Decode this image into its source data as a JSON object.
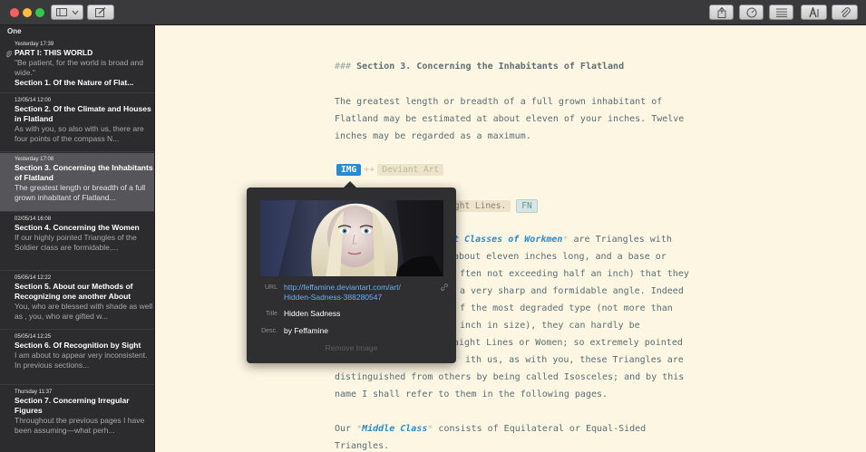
{
  "titlebar": {
    "icons": [
      "sidebar-toggle-icon",
      "chevron-down-icon",
      "compose-icon",
      "share-icon",
      "stats-icon",
      "list-icon",
      "typography-icon",
      "attachment-icon"
    ]
  },
  "sidebar": {
    "header": "One",
    "notes": [
      {
        "date": "Yesterday 17:39",
        "title": "PART I: THIS WORLD",
        "excerpt": "\"Be patient, for the world is broad and wide.\"",
        "excerpt_bold": "Section 1. Of the Nature of Flat...",
        "attached": true
      },
      {
        "date": "12/05/14 12:00",
        "title": "Section 2. Of the Climate and Houses in Flatland",
        "excerpt": "As with you, so also with us, there are four points of the compass N..."
      },
      {
        "date": "Yesterday 17:08",
        "title": "Section 3. Concerning the Inhabitants of Flatland",
        "excerpt": "The greatest length or breadth of a full grown inhabitant of Flatland...",
        "selected": true
      },
      {
        "date": "02/05/14 16:08",
        "title": "Section 4. Concerning the Women",
        "excerpt": "If our highly pointed Triangles of the Soldier class are formidable,..."
      },
      {
        "date": "05/05/14 12:22",
        "title": "Section 5. About our Methods of Recognizing one another About",
        "excerpt": "You, who are blessed with shade as well as , you, who are gifted w..."
      },
      {
        "date": "05/05/14 12:25",
        "title": "Section 6. Of Recognition by Sight",
        "excerpt": "I am about to appear very inconsistent. In previous sections..."
      },
      {
        "date": "Thursday 11:37",
        "title": "Section 7. Concerning Irregular Figures",
        "excerpt": "Throughout the previous pages I have been assuming—what perh..."
      }
    ]
  },
  "editor": {
    "heading_marker": "###",
    "heading_text": "Section 3. Concerning the Inhabitants of Flatland",
    "para1": [
      "The greatest length or breadth of a full grown inhabitant of",
      "Flatland may be estimated at about eleven of your inches. Twelve",
      "inches may be regarded as a maximum."
    ],
    "img_tag": "IMG",
    "img_arrows": "++",
    "deviant_tag": "Deviant Art",
    "sl_tag": "ght Lines.",
    "fn_tag": "FN",
    "workmen_em": "st Classes of Workmen",
    "workmen_mark": "*",
    "workmen_rest": " are Triangles with",
    "lines": [
      "about eleven inches long, and a base or",
      "ften not exceeding half an inch) that they",
      "a very sharp and formidable angle. Indeed",
      "f the most degraded type (not more than",
      "inch in size), they can hardly be",
      "aight Lines or Women; so extremely pointed",
      "ith us, as with you, these Triangles are",
      "distinguished from others by being called Isosceles; and by this",
      "name I shall refer to them in the following pages."
    ],
    "middle_prefix": "Our ",
    "middle_mark": "*",
    "middle_em": "Middle Class",
    "middle_rest": " consists of Equilateral or Equal-Sided",
    "last_line": "Triangles."
  },
  "popover": {
    "url_label": "URL",
    "url_value_1": "http://feffamine.deviantart.com/art/",
    "url_value_2": "Hidden-Sadness-388280547",
    "title_label": "Title",
    "title_value": "Hidden Sadness",
    "desc_label": "Desc.",
    "desc_value": "by Feffamine",
    "remove_label": "Remove Image"
  },
  "colors": {
    "accent": "#268bd2",
    "editor_bg": "#fdf6e3",
    "sidebar_bg": "#2c2c2e",
    "popover_bg": "#2f2f31"
  }
}
